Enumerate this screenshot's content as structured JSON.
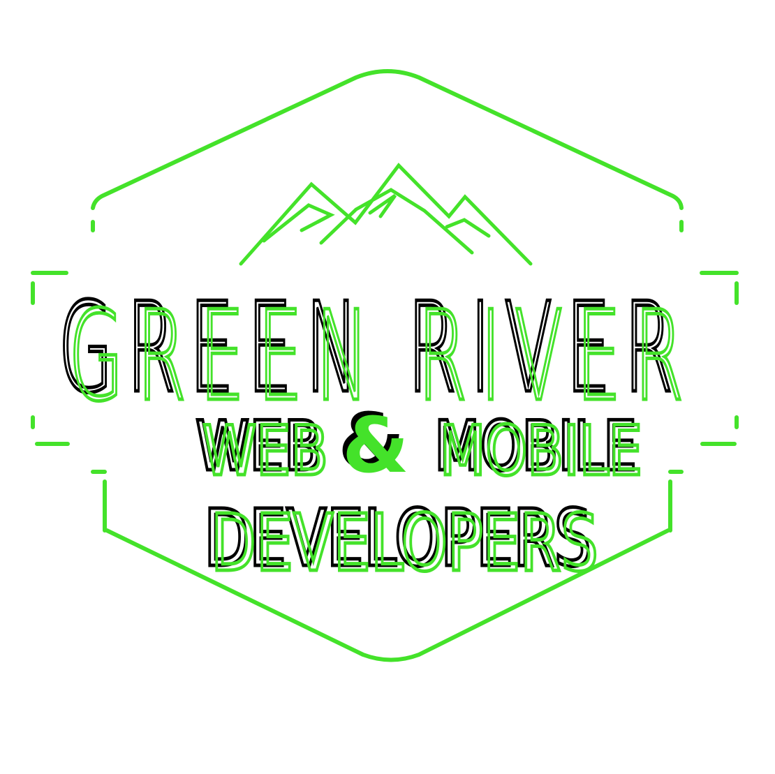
{
  "logo": {
    "line1": "GREEN RIVER",
    "line2_left": "WEB",
    "line2_amp": "&",
    "line2_right": "MOBILE",
    "line3": "DEVELOPERS"
  },
  "colors": {
    "accent": "#44e22a",
    "shadow": "#000000",
    "background": "#ffffff"
  },
  "icons": [
    "mountain-icon",
    "hexagon-frame"
  ]
}
